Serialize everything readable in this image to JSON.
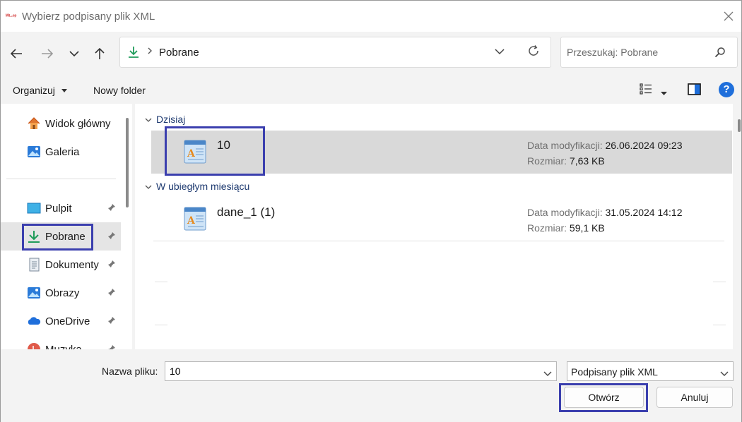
{
  "window": {
    "title": "Wybierz podpisany plik XML",
    "app_icon_text": "ᴹᴵᴸ-ᵉᵖ"
  },
  "address": {
    "crumb": "Pobrane"
  },
  "search": {
    "placeholder": "Przeszukaj: Pobrane"
  },
  "toolbar": {
    "organize_label": "Organizuj",
    "new_folder_label": "Nowy folder",
    "help_label": "?"
  },
  "sidebar": {
    "items": [
      {
        "label": "Widok główny",
        "icon": "home-icon",
        "pinned": false
      },
      {
        "label": "Galeria",
        "icon": "gallery-icon",
        "pinned": false
      },
      {
        "label": "Pulpit",
        "icon": "desktop-icon",
        "pinned": true
      },
      {
        "label": "Pobrane",
        "icon": "download-icon",
        "pinned": true,
        "selected": true
      },
      {
        "label": "Dokumenty",
        "icon": "documents-icon",
        "pinned": true
      },
      {
        "label": "Obrazy",
        "icon": "pictures-icon",
        "pinned": true
      },
      {
        "label": "OneDrive",
        "icon": "onedrive-icon",
        "pinned": true
      },
      {
        "label": "Muzyka",
        "icon": "music-icon",
        "pinned": true
      }
    ]
  },
  "files": {
    "groups": [
      {
        "header": "Dzisiaj",
        "items": [
          {
            "name": "10",
            "modified_label": "Data modyfikacji:",
            "modified": "26.06.2024 09:23",
            "size_label": "Rozmiar:",
            "size": "7,63 KB",
            "selected": true
          }
        ]
      },
      {
        "header": "W ubiegłym miesiącu",
        "items": [
          {
            "name": "dane_1 (1)",
            "modified_label": "Data modyfikacji:",
            "modified": "31.05.2024 14:12",
            "size_label": "Rozmiar:",
            "size": "59,1 KB",
            "selected": false
          }
        ]
      }
    ]
  },
  "bottom": {
    "filename_label": "Nazwa pliku:",
    "filename_value": "10",
    "filetype_value": "Podpisany plik XML",
    "open_label": "Otwórz",
    "cancel_label": "Anuluj"
  },
  "colors": {
    "highlight_box": "#3b3fae",
    "accent_green": "#1f9c5a",
    "help_blue": "#1f6fdb"
  }
}
